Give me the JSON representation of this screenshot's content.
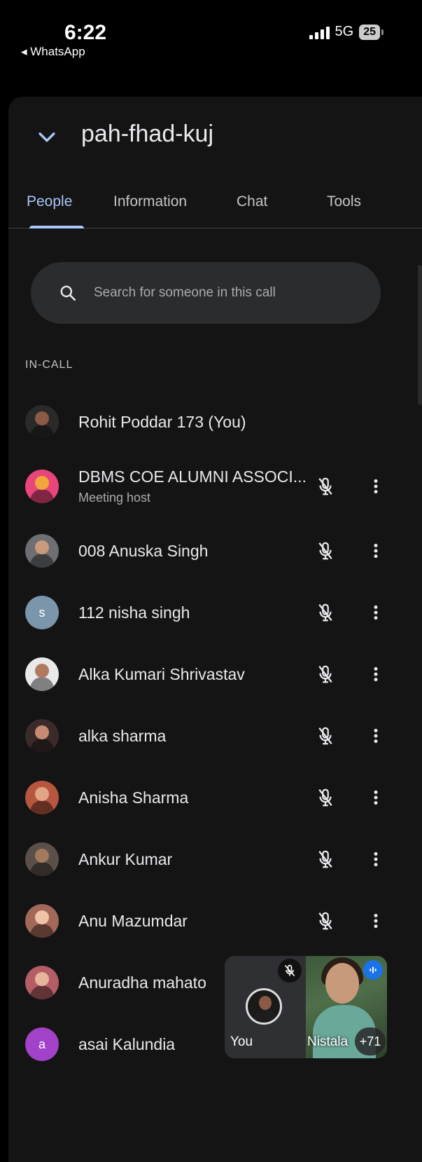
{
  "status": {
    "time": "6:22",
    "back_label": "◂ WhatsApp",
    "network": "5G",
    "battery": "25"
  },
  "header": {
    "meeting_code": "pah-fhad-kuj"
  },
  "tabs": [
    {
      "label": "People",
      "active": true
    },
    {
      "label": "Information",
      "active": false
    },
    {
      "label": "Chat",
      "active": false
    },
    {
      "label": "Tools",
      "active": false
    }
  ],
  "search": {
    "placeholder": "Search for someone in this call"
  },
  "section_label": "IN-CALL",
  "participants": [
    {
      "name": "Rohit Poddar 173 (You)",
      "sub": "",
      "avatar_color": "#2a2a2a",
      "skin": "#8a5a44",
      "initial": ""
    },
    {
      "name": "DBMS COE ALUMNI ASSOCI...",
      "sub": "Meeting host",
      "avatar_color": "#e8457a",
      "skin": "#f2a53c",
      "initial": ""
    },
    {
      "name": "008 Anuska Singh",
      "sub": "",
      "avatar_color": "#6d6f72",
      "skin": "#c99a7c",
      "initial": ""
    },
    {
      "name": "112 nisha singh",
      "sub": "",
      "avatar_color": "#7b96ab",
      "skin": "",
      "initial": "s"
    },
    {
      "name": "Alka Kumari Shrivastav",
      "sub": "",
      "avatar_color": "#e9e9e9",
      "skin": "#b07a60",
      "initial": ""
    },
    {
      "name": "alka sharma",
      "sub": "",
      "avatar_color": "#3b2a2a",
      "skin": "#c78a72",
      "initial": ""
    },
    {
      "name": "Anisha Sharma",
      "sub": "",
      "avatar_color": "#b7563f",
      "skin": "#e2a487",
      "initial": ""
    },
    {
      "name": "Ankur Kumar",
      "sub": "",
      "avatar_color": "#5a5049",
      "skin": "#a47a5e",
      "initial": ""
    },
    {
      "name": "Anu Mazumdar",
      "sub": "",
      "avatar_color": "#a2685a",
      "skin": "#f0c3a8",
      "initial": ""
    },
    {
      "name": "Anuradha mahato",
      "sub": "",
      "avatar_color": "#b45d66",
      "skin": "#e6b59a",
      "initial": ""
    },
    {
      "name": "asai Kalundia",
      "sub": "",
      "avatar_color": "#a142c9",
      "skin": "",
      "initial": "a"
    }
  ],
  "pip": {
    "you_label": "You",
    "other_label": "Nistala",
    "extra_count": "+71"
  },
  "colors": {
    "accent": "#a8c7fa",
    "surface": "#141414",
    "search_bg": "#2b2c2e"
  },
  "icons": {
    "collapse": "chevron-down-icon",
    "search": "search-icon",
    "mic_off": "mic-off-icon",
    "more": "more-vert-icon",
    "speaking": "audio-level-icon"
  }
}
